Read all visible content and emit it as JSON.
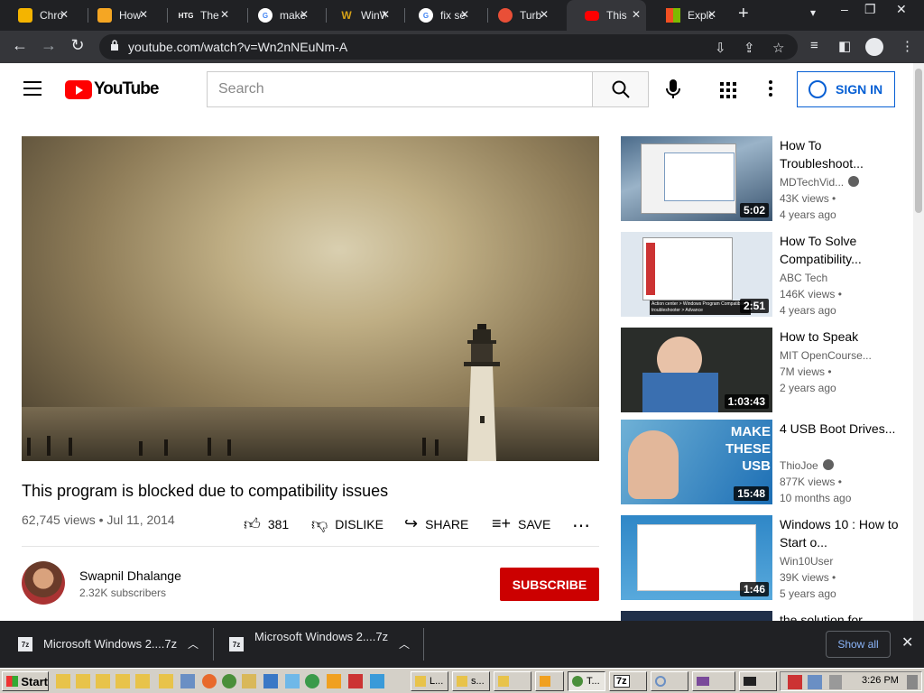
{
  "browser": {
    "tabs": [
      {
        "title": "Chro",
        "icon": "chrome-icon",
        "color": "#f4b400"
      },
      {
        "title": "How",
        "icon": "howtogeek-icon",
        "color": "#f5a623"
      },
      {
        "title": "The",
        "icon": "htg-icon",
        "color": "#202124",
        "badge": "HTG"
      },
      {
        "title": "make",
        "icon": "google-icon",
        "color": "#4285f4"
      },
      {
        "title": "WinW",
        "icon": "winworld-icon",
        "color": "#d4a017"
      },
      {
        "title": "fix se",
        "icon": "google-icon",
        "color": "#4285f4"
      },
      {
        "title": "Turb",
        "icon": "turbo-icon",
        "color": "#e94f37"
      },
      {
        "title": "This",
        "icon": "youtube-icon",
        "color": "#ff0000",
        "active": true
      },
      {
        "title": "Explo",
        "icon": "microsoft-icon",
        "color": "#f25022"
      }
    ],
    "url": "youtube.com/watch?v=Wn2nNEuNm-A"
  },
  "youtube": {
    "search_placeholder": "Search",
    "sign_in_label": "SIGN IN",
    "video": {
      "title": "This program is blocked due to compatibility issues",
      "meta": "62,745 views • Jul 11, 2014",
      "likes": "381",
      "dislike_label": "DISLIKE",
      "share_label": "SHARE",
      "save_label": "SAVE"
    },
    "channel": {
      "name": "Swapnil Dhalange",
      "subscribers": "2.32K subscribers",
      "subscribe_label": "SUBSCRIBE"
    },
    "recommendations": [
      {
        "title": "How To Troubleshoot...",
        "channel": "MDTechVid...",
        "verified": true,
        "views": "43K views •",
        "age": "4 years ago",
        "duration": "5:02"
      },
      {
        "title": "How To Solve Compatibility...",
        "channel": "ABC Tech",
        "verified": false,
        "views": "146K views •",
        "age": "4 years ago",
        "duration": "2:51",
        "caption": "Action center > Windows Program Compatibility troubleshooter > Advance"
      },
      {
        "title": "How to Speak",
        "channel": "MIT OpenCourse...",
        "verified": false,
        "views": "7M views •",
        "age": "2 years ago",
        "duration": "1:03:43"
      },
      {
        "title": "4 USB Boot Drives...",
        "channel": "ThioJoe",
        "verified": true,
        "views": "877K views •",
        "age": "10 months ago",
        "duration": "15:48",
        "thumb_text": "MAKE THESE USB"
      },
      {
        "title": "Windows 10 : How to Start o...",
        "channel": "Win10User",
        "verified": false,
        "views": "39K views •",
        "age": "5 years ago",
        "duration": "1:46"
      },
      {
        "title": "the solution for...",
        "channel": "",
        "verified": false,
        "views": "",
        "age": "",
        "duration": ""
      }
    ]
  },
  "downloads": {
    "items": [
      {
        "name": "Microsoft Windows 2....7z",
        "icon_text": "7z"
      },
      {
        "name": "Microsoft Windows 2....7z",
        "icon_text": "7z"
      }
    ],
    "show_all_label": "Show all"
  },
  "taskbar": {
    "start_label": "Start",
    "buttons": [
      {
        "label": "L...",
        "icon": "folder-icon"
      },
      {
        "label": "s...",
        "icon": "folder-icon"
      },
      {
        "label": "",
        "icon": "folder-icon"
      },
      {
        "label": "",
        "icon": "media-icon"
      },
      {
        "label": "T...",
        "icon": "chrome-icon",
        "active": true
      },
      {
        "label": "7z",
        "icon": "7zip-icon"
      },
      {
        "label": "",
        "icon": "magnifier-icon"
      },
      {
        "label": "",
        "icon": "tools-icon"
      },
      {
        "label": "",
        "icon": "cmd-icon"
      }
    ],
    "clock": "3:26 PM"
  }
}
